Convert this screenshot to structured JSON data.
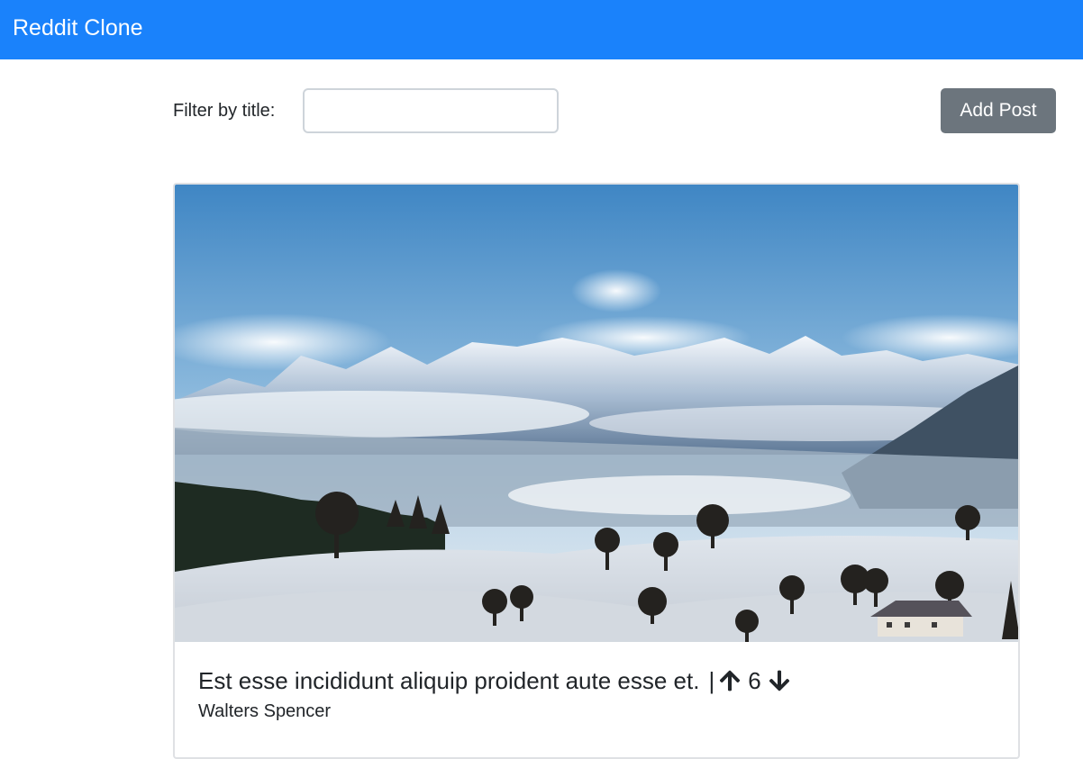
{
  "navbar": {
    "brand": "Reddit Clone",
    "color": "#1a82fb"
  },
  "toolbar": {
    "filter_label": "Filter by title:",
    "filter_value": "",
    "filter_placeholder": "",
    "add_post_label": "Add Post"
  },
  "posts": [
    {
      "image": "snowy-mountain-landscape",
      "title": "Est esse incididunt aliquip proident aute esse et.",
      "separator": "|",
      "upvote_icon": "arrow-up-icon",
      "score": "6",
      "downvote_icon": "arrow-down-icon",
      "author": "Walters Spencer"
    }
  ]
}
